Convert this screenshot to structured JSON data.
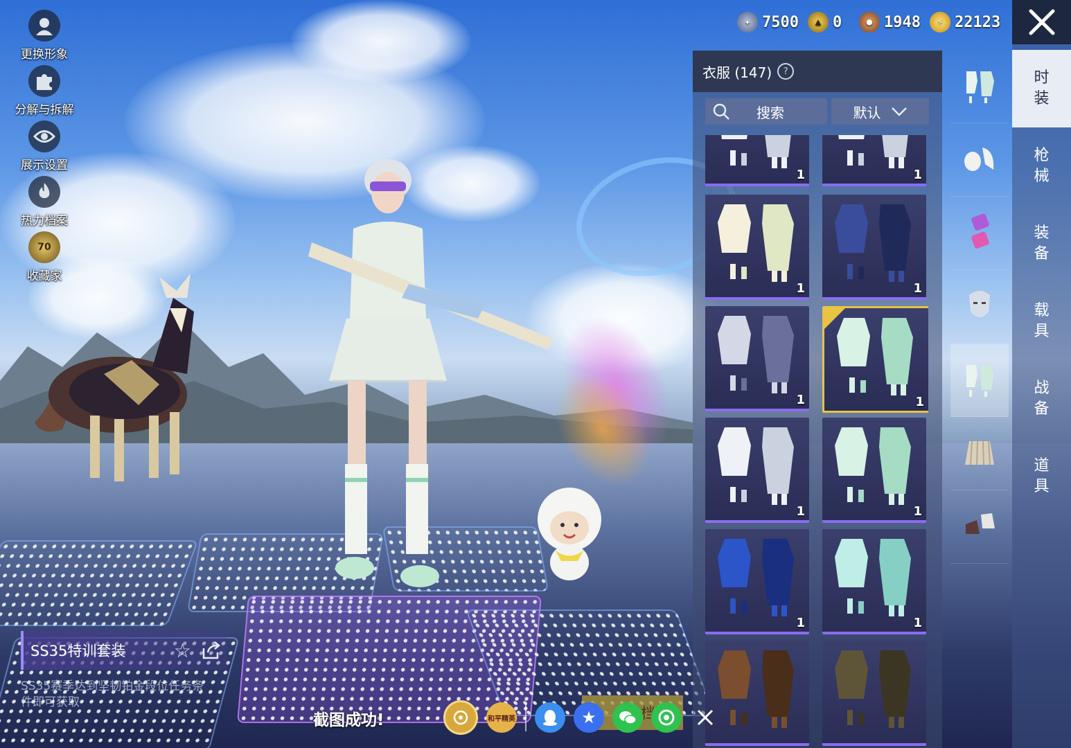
{
  "currency": [
    {
      "icon": "bronze-medal-icon",
      "value": "7500",
      "color": "#6d7fa6"
    },
    {
      "icon": "gold-badge-icon",
      "value": "0",
      "color": "#c99a1d"
    },
    {
      "icon": "copper-coin-icon",
      "value": "1948",
      "color": "#a6652b"
    },
    {
      "icon": "lightning-coin-icon",
      "value": "22123",
      "color": "#e9b91a"
    }
  ],
  "left_menu": [
    {
      "label": "更换形象",
      "icon": "avatar-icon"
    },
    {
      "label": "分解与拆解",
      "icon": "puzzle-icon"
    },
    {
      "label": "展示设置",
      "icon": "eye-icon"
    },
    {
      "label": "热力档案",
      "icon": "flame-icon"
    },
    {
      "label": "收藏家",
      "icon": "collector-badge-icon",
      "badge": "70"
    }
  ],
  "panel": {
    "title": "衣服 (147)",
    "search_label": "搜索",
    "sort_label": "默认"
  },
  "items": [
    {
      "count": "1",
      "palette": "white"
    },
    {
      "count": "1",
      "palette": "white"
    },
    {
      "count": "1",
      "palette": "cream"
    },
    {
      "count": "1",
      "palette": "navy"
    },
    {
      "count": "1",
      "palette": "silver"
    },
    {
      "count": "1",
      "palette": "mint",
      "selected": true
    },
    {
      "count": "1",
      "palette": "white"
    },
    {
      "count": "1",
      "palette": "mint"
    },
    {
      "count": "1",
      "palette": "blue"
    },
    {
      "count": "1",
      "palette": "teal"
    },
    {
      "count": "",
      "palette": "brown"
    },
    {
      "count": "",
      "palette": "olive"
    }
  ],
  "subcategories": [
    {
      "icon": "full-outfit-icon",
      "active": false
    },
    {
      "icon": "hair-icon",
      "active": false
    },
    {
      "icon": "eyewear-icon",
      "active": false
    },
    {
      "icon": "face-mask-icon",
      "active": false
    },
    {
      "icon": "full-outfit-icon",
      "active": true
    },
    {
      "icon": "skirt-icon",
      "active": false
    },
    {
      "icon": "shoes-icon",
      "active": false
    }
  ],
  "tabs": [
    {
      "label": "时装",
      "active": true
    },
    {
      "label": "枪械",
      "active": false
    },
    {
      "label": "装备",
      "active": false
    },
    {
      "label": "载具",
      "active": false
    },
    {
      "label": "战备",
      "active": false
    },
    {
      "label": "道具",
      "active": false
    }
  ],
  "outfit": {
    "name": "SS35特训套装",
    "description": "SS35赛季达到坚韧铂金段位任务条件即可获取"
  },
  "share": {
    "screenshot_text": "截图成功!",
    "save_label": "存档",
    "game_logo_text": "和平精英",
    "buttons": [
      {
        "icon": "peace-elite-icon",
        "color": "#d8a83a"
      },
      {
        "icon": "game-logo-icon",
        "color": "#e6b34a"
      },
      {
        "icon": "qq-icon",
        "color": "#3a8ff0"
      },
      {
        "icon": "qzone-icon",
        "color": "#3a6ff0"
      },
      {
        "icon": "wechat-icon",
        "color": "#2fc24f"
      },
      {
        "icon": "moments-icon",
        "color": "#2fc24f"
      },
      {
        "icon": "close-share-icon",
        "color": "transparent"
      }
    ]
  }
}
